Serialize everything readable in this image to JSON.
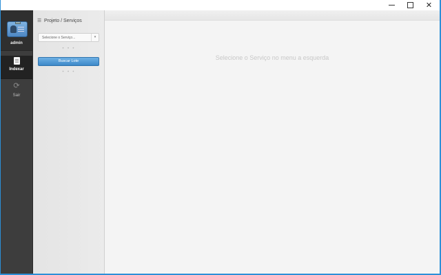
{
  "window": {
    "minimize_icon": "minimize-icon",
    "maximize_icon": "maximize-icon",
    "close_glyph": "✕"
  },
  "sidebar": {
    "user": {
      "name": "admin",
      "icon": "user-badge-icon"
    },
    "items": [
      {
        "label": "Indexar",
        "icon": "document-icon",
        "active": true
      },
      {
        "label": "Sair",
        "icon": "refresh-icon",
        "glyph": "⟳",
        "active": false
      }
    ]
  },
  "panel": {
    "title": "Projeto / Serviços",
    "title_icon_glyph": "☰",
    "select": {
      "placeholder": "Selecione o Serviço...",
      "caret": "▾"
    },
    "dots": "• • •",
    "search_button": "Buscar Lote"
  },
  "main": {
    "empty_message": "Selecione o Serviço no menu a esquerda"
  },
  "colors": {
    "accent": "#3d88c8",
    "sidebar_bg": "#3d3d3d",
    "window_border": "#2c8fd8"
  }
}
